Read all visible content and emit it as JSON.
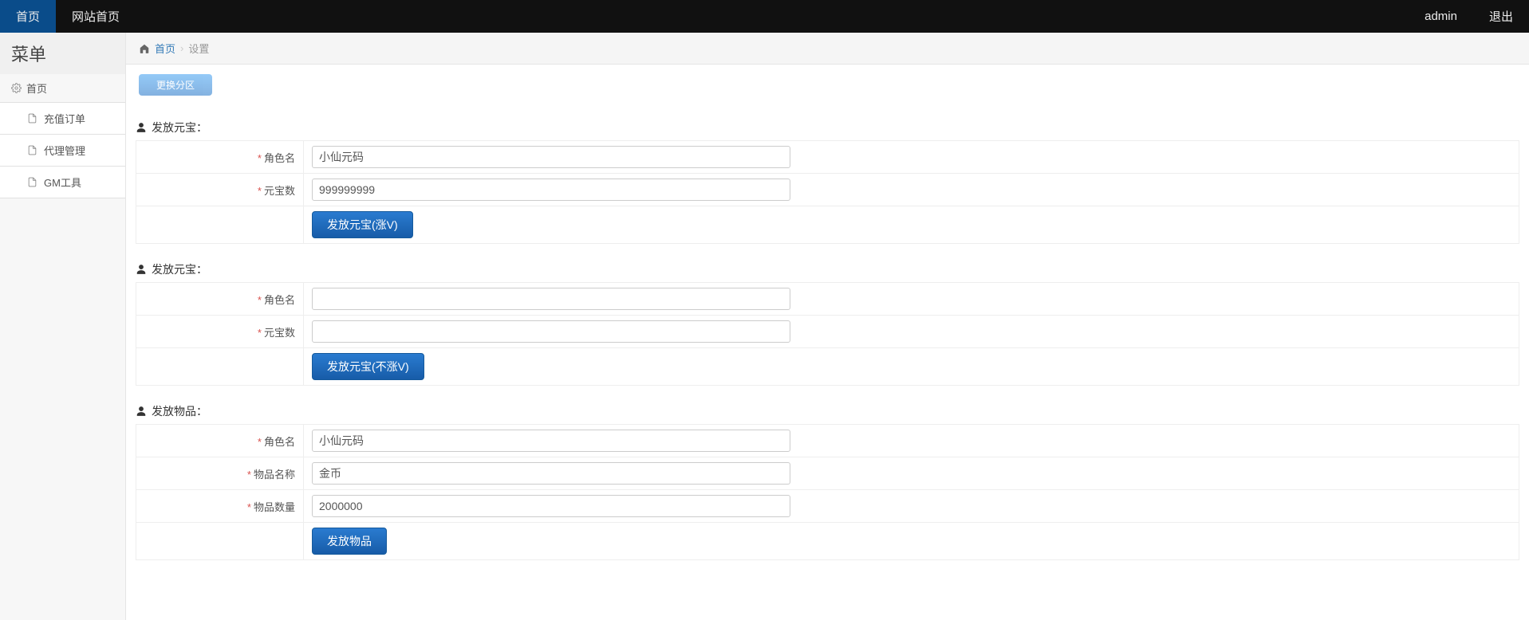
{
  "topbar": {
    "home": "首页",
    "site_home": "网站首页",
    "user": "admin",
    "logout": "退出"
  },
  "sidebar": {
    "title": "菜单",
    "section_home": "首页",
    "items": [
      {
        "label": "充值订单"
      },
      {
        "label": "代理管理"
      },
      {
        "label": "GM工具"
      }
    ]
  },
  "breadcrumb": {
    "home": "首页",
    "current": "设置"
  },
  "switch_zone": "更换分区",
  "sections": {
    "yb_v": {
      "title": "发放元宝：",
      "role_label": "角色名",
      "role_value": "小仙元码",
      "count_label": "元宝数",
      "count_value": "999999999",
      "button": "发放元宝(涨V)"
    },
    "yb_nv": {
      "title": "发放元宝：",
      "role_label": "角色名",
      "role_value": "",
      "count_label": "元宝数",
      "count_value": "",
      "button": "发放元宝(不涨V)"
    },
    "item": {
      "title": "发放物品：",
      "role_label": "角色名",
      "role_value": "小仙元码",
      "item_label": "物品名称",
      "item_value": "金币",
      "qty_label": "物品数量",
      "qty_value": "2000000",
      "button": "发放物品"
    }
  }
}
